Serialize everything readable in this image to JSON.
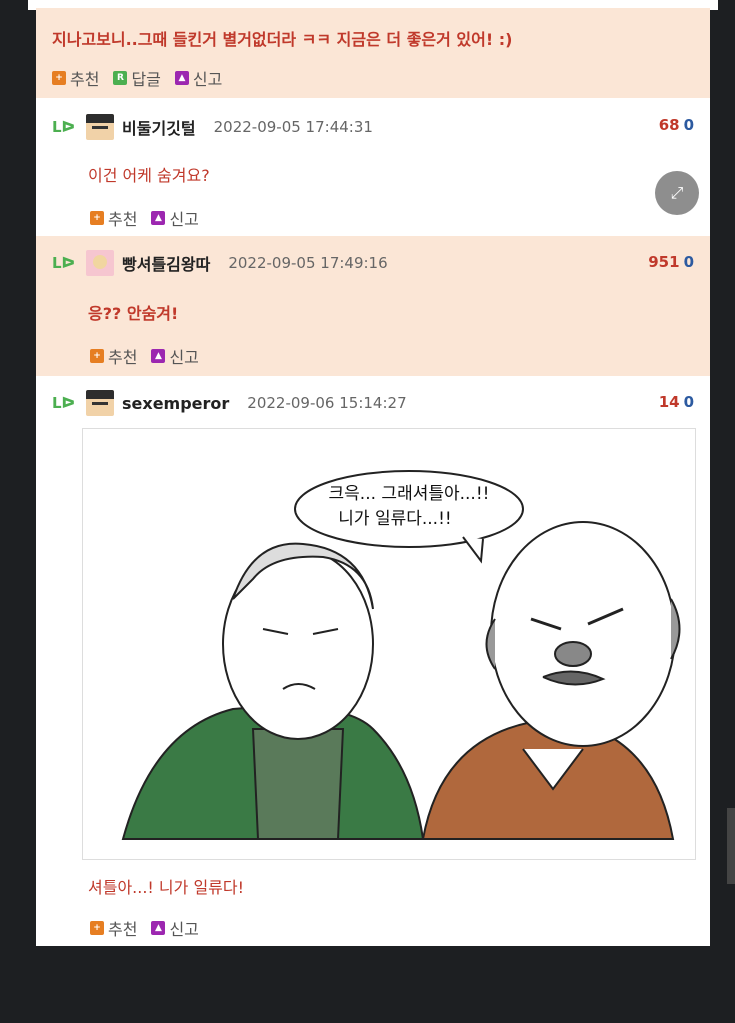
{
  "comments": [
    {
      "message": "지나고보니..그때 들킨거 별거없더라 ㅋㅋ 지금은 더 좋은거 있어! :)",
      "actions": {
        "recommend": "추천",
        "reply": "답글",
        "report": "신고"
      }
    },
    {
      "nickname": "비둘기깃털",
      "date": "2022-09-05 17:44:31",
      "score_up": "68",
      "score_down": "0",
      "message": "이건 어케 숨겨요?",
      "actions": {
        "recommend": "추천",
        "report": "신고"
      }
    },
    {
      "nickname": "빵셔틀김왕따",
      "date": "2022-09-05 17:49:16",
      "score_up": "951",
      "score_down": "0",
      "message": "응?? 안숨겨!",
      "actions": {
        "recommend": "추천",
        "report": "신고"
      }
    },
    {
      "nickname": "sexemperor",
      "date": "2022-09-06 15:14:27",
      "score_up": "14",
      "score_down": "0",
      "comic_bubble_line1": "크윽... 그래셔틀아...!!",
      "comic_bubble_line2": "니가 일류다...!!",
      "message": "셔틀아...! 니가 일류다!",
      "actions": {
        "recommend": "추천",
        "report": "신고"
      }
    }
  ],
  "reply_arrow": "Lᐅ",
  "icons": {
    "reply_arrow": "reply-arrow-icon",
    "recommend": "recommend-icon",
    "reply": "reply-icon",
    "report": "report-icon",
    "expand": "expand-icon"
  },
  "colors": {
    "highlight_bg": "#fbe6d6",
    "message_red": "#c0392b",
    "score_down_blue": "#2c5aa0"
  }
}
